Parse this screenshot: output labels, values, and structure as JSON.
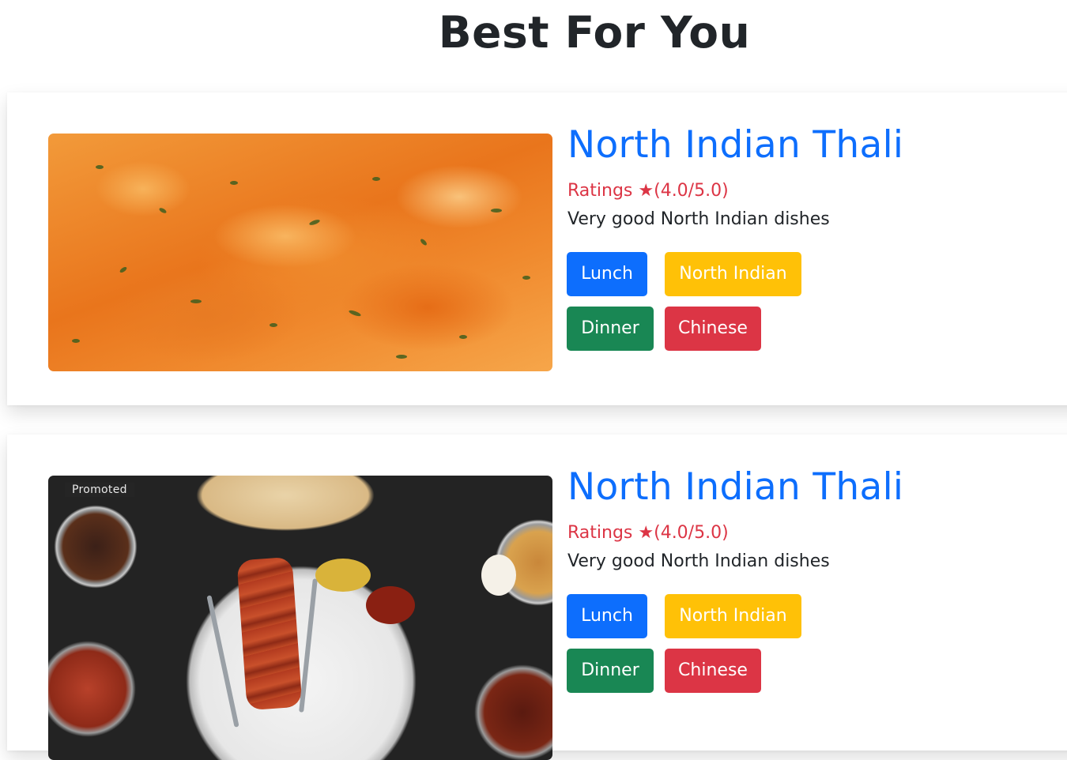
{
  "page": {
    "title": "Best For You"
  },
  "cards": [
    {
      "title": "North Indian Thali",
      "ratings": "Ratings ★(4.0/5.0)",
      "description": "Very good North Indian dishes",
      "tags": [
        "Lunch",
        "North Indian",
        "Dinner",
        "Chinese"
      ],
      "image": "paneer-butter-masala-photo"
    },
    {
      "title": "North Indian Thali",
      "ratings": "Ratings ★(4.0/5.0)",
      "description": "Very good North Indian dishes",
      "tags": [
        "Lunch",
        "North Indian",
        "Dinner",
        "Chinese"
      ],
      "image": "north-indian-thali-photo",
      "image_badge": "Promoted"
    }
  ],
  "colors": {
    "title": "#0d6efd",
    "ratings": "#dc3545",
    "tag_lunch": "#0d6efd",
    "tag_north_indian": "#ffc107",
    "tag_dinner": "#198754",
    "tag_chinese": "#dc3545"
  }
}
